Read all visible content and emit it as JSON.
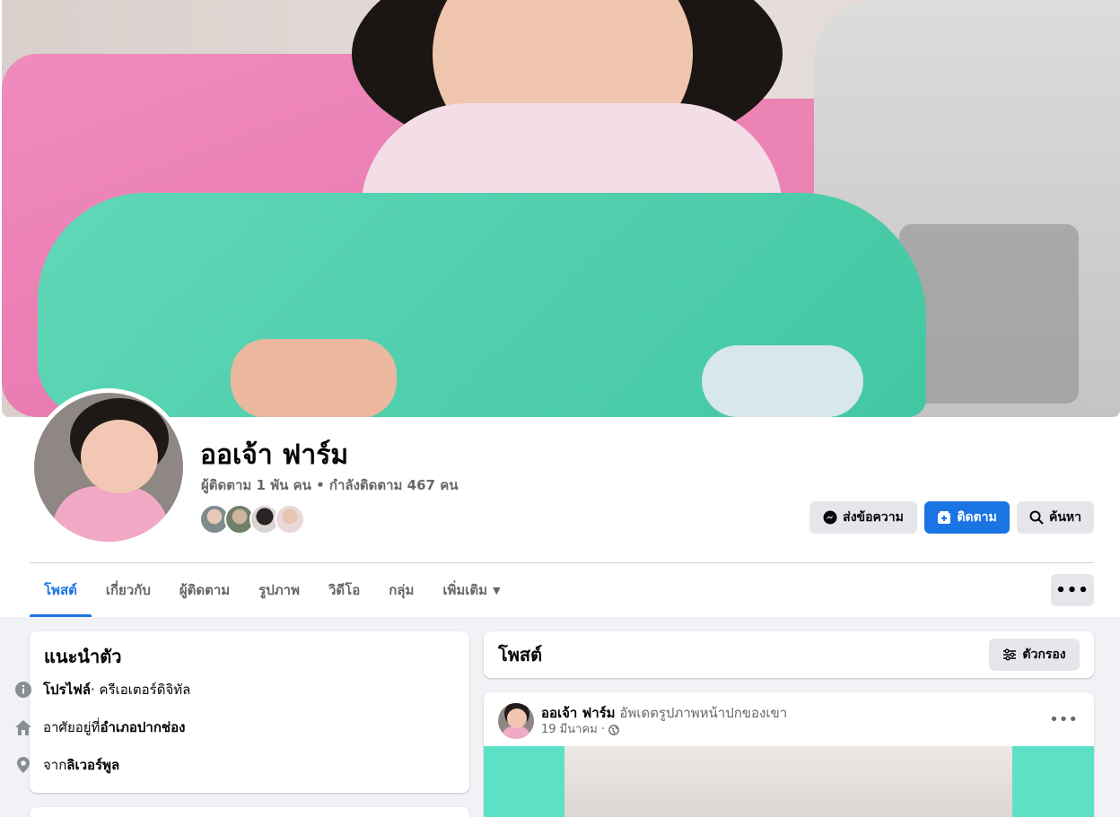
{
  "profile": {
    "name": "ออเจ้า ฟาร์ม",
    "stats": "ผู้ติดตาม 1 พัน คน • กำลังติดตาม 467 คน"
  },
  "actions": {
    "message": "ส่งข้อความ",
    "follow": "ติดตาม",
    "search": "ค้นหา",
    "more": "•••"
  },
  "tabs": [
    {
      "label": "โพสต์",
      "active": true
    },
    {
      "label": "เกี่ยวกับ"
    },
    {
      "label": "ผู้ติดตาม"
    },
    {
      "label": "รูปภาพ"
    },
    {
      "label": "วิดีโอ"
    },
    {
      "label": "กลุ่ม"
    },
    {
      "label": "เพิ่มเติม"
    }
  ],
  "intro": {
    "title": "แนะนำตัว",
    "profile_label": "โปรไฟล์",
    "profile_category": " · ครีเอเตอร์ดิจิทัล",
    "lives_prefix": "อาศัยอยู่ที่ ",
    "lives_place": "อำเภอปากช่อง",
    "from_prefix": "จาก ",
    "from_place": "ลิเวอร์พูล"
  },
  "posts": {
    "title": "โพสต์",
    "filter_label": "ตัวกรอง",
    "first_post": {
      "author": "ออเจ้า ฟาร์ม",
      "action": " อัพเดตรูปภาพหน้าปกของเขา",
      "date": "19 มีนาคม ·",
      "options": "•••"
    }
  },
  "colors": {
    "accent": "#1b74e4",
    "secondary_text": "#65676b",
    "page_bg": "#f0f2f5",
    "button_gray": "#e4e6eb"
  },
  "icons": [
    "messenger-icon",
    "follow-plus-icon",
    "search-icon",
    "info-icon",
    "home-icon",
    "location-pin-icon",
    "filter-icon",
    "globe-icon",
    "caret-down-icon"
  ]
}
